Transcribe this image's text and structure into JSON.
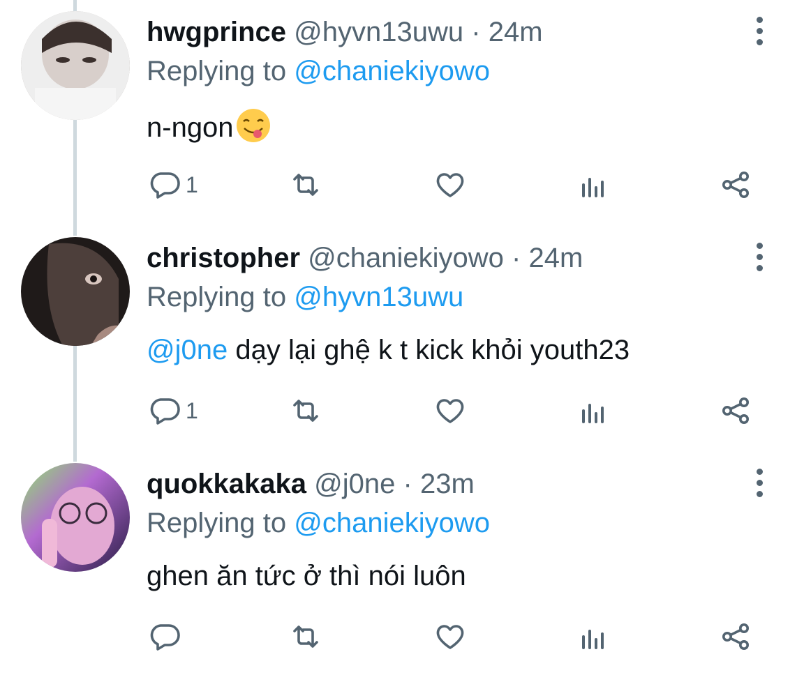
{
  "tweets": [
    {
      "display_name": "hwgprince",
      "handle": "@hyvn13uwu",
      "separator": "·",
      "time": "24m",
      "replying_prefix": "Replying to",
      "replying_to": "@chaniekiyowo",
      "text": "n-ngon",
      "emoji": "face-savoring-food-emoji",
      "reply_count": "1",
      "avatar_colors": [
        "#f0f0f0",
        "#d9d4d2",
        "#7a6b66"
      ]
    },
    {
      "display_name": "christopher",
      "handle": "@chaniekiyowo",
      "separator": "·",
      "time": "24m",
      "replying_prefix": "Replying to",
      "replying_to": "@hyvn13uwu",
      "mention": "@j0ne",
      "text": " dạy lại ghệ k t kick khỏi youth23",
      "reply_count": "1",
      "avatar_colors": [
        "#2b2422",
        "#5a4a44",
        "#b08f85"
      ]
    },
    {
      "display_name": "quokkakaka",
      "handle": "@j0ne",
      "separator": "·",
      "time": "23m",
      "replying_prefix": "Replying to",
      "replying_to": "@chaniekiyowo",
      "text": "ghen ăn tức ở thì nói luôn",
      "reply_count": "",
      "avatar_colors": [
        "#3a2a5c",
        "#c07ad6",
        "#9be07a"
      ]
    }
  ],
  "colors": {
    "text_primary": "#0f1419",
    "text_secondary": "#536471",
    "accent": "#1d9bf0",
    "thread_line": "#cfd9de"
  },
  "icons": [
    "reply-icon",
    "retweet-icon",
    "like-icon",
    "analytics-icon",
    "share-icon",
    "more-options-icon"
  ]
}
